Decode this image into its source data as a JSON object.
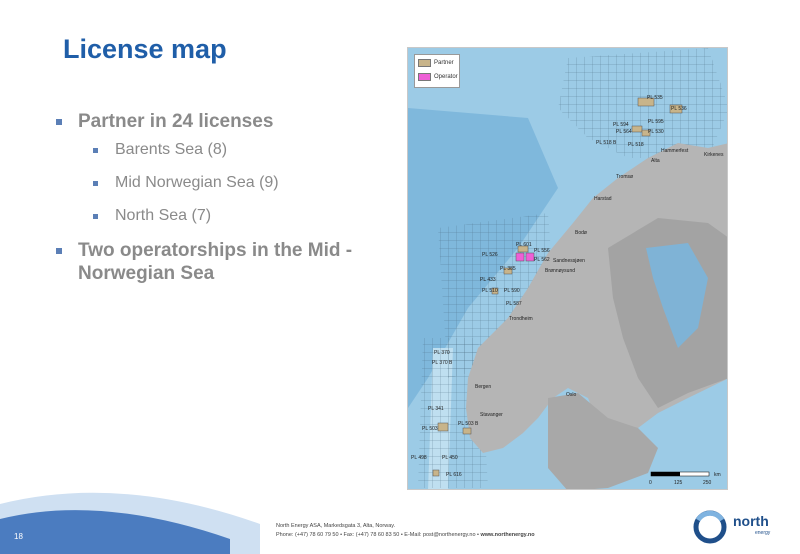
{
  "slide": {
    "title": "License map",
    "page_number": "18"
  },
  "bullets": {
    "main1": "Partner in 24 licenses",
    "sub": [
      "Barents Sea (8)",
      "Mid Norwegian Sea (9)",
      "North Sea (7)"
    ],
    "main2_line1": "Two operatorships in the Mid -",
    "main2_line2": "Norwegian Sea"
  },
  "map": {
    "legend": {
      "partner": "Partner",
      "operator": "Operator",
      "partner_color": "#c8b48a",
      "operator_color": "#ee5fd6"
    },
    "licenses": [
      "PL 535",
      "PL 536",
      "PL 595",
      "PL 594",
      "PL 564",
      "PL 530",
      "PL 518 B",
      "PL 518",
      "PL 601",
      "PL 526",
      "PL 556",
      "PL 562",
      "PL 385",
      "PL 433",
      "PL 510",
      "PL 590",
      "PL 587",
      "PL 370",
      "PL 370 B",
      "PL 341",
      "PL 503",
      "PL 503 B",
      "PL 498",
      "PL 450",
      "PL 616"
    ],
    "places": [
      "Hammerfest",
      "Kirkenes",
      "Alta",
      "Tromsø",
      "Harstad",
      "Bodø",
      "Sandnessjøen",
      "Brønnøysund",
      "Trondheim",
      "Bergen",
      "Oslo",
      "Stavanger"
    ],
    "scale": {
      "unit": "km",
      "ticks": [
        "0",
        "125",
        "250"
      ]
    }
  },
  "footer": {
    "line1": "North Energy ASA, Markedsgata 3, Alta, Norway.",
    "line2_contact": "Phone: (+47) 78 60 79 50  • Fax: (+47) 78 60 83 50  • E-Mail: post@northenergy.no  •",
    "line2_web": "www.northenergy.no",
    "logo_word": "north",
    "logo_sub": "energy"
  }
}
